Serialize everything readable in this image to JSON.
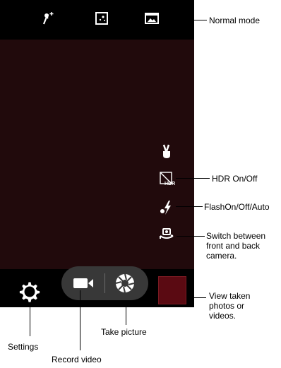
{
  "annotations": {
    "normal_mode": "Normal mode",
    "hdr": "HDR On/Off",
    "flash": "FlashOn/Off/Auto",
    "switch_camera": "Switch between\nfront and back\ncamera.",
    "view_taken": "View taken\nphotos or\nvideos.",
    "take_picture": "Take picture",
    "settings": "Settings",
    "record_video": "Record video"
  },
  "icons": {
    "top": [
      "magic-effects-icon",
      "scene-mode-icon",
      "normal-mode-icon"
    ],
    "side": [
      "gesture-shot-icon",
      "hdr-icon",
      "flash-auto-icon",
      "switch-camera-icon"
    ],
    "bottom": [
      "settings-icon",
      "video-camera-icon",
      "shutter-icon"
    ]
  },
  "colors": {
    "viewfinder": "#210a0c",
    "thumbnail": "#5a0a12"
  }
}
